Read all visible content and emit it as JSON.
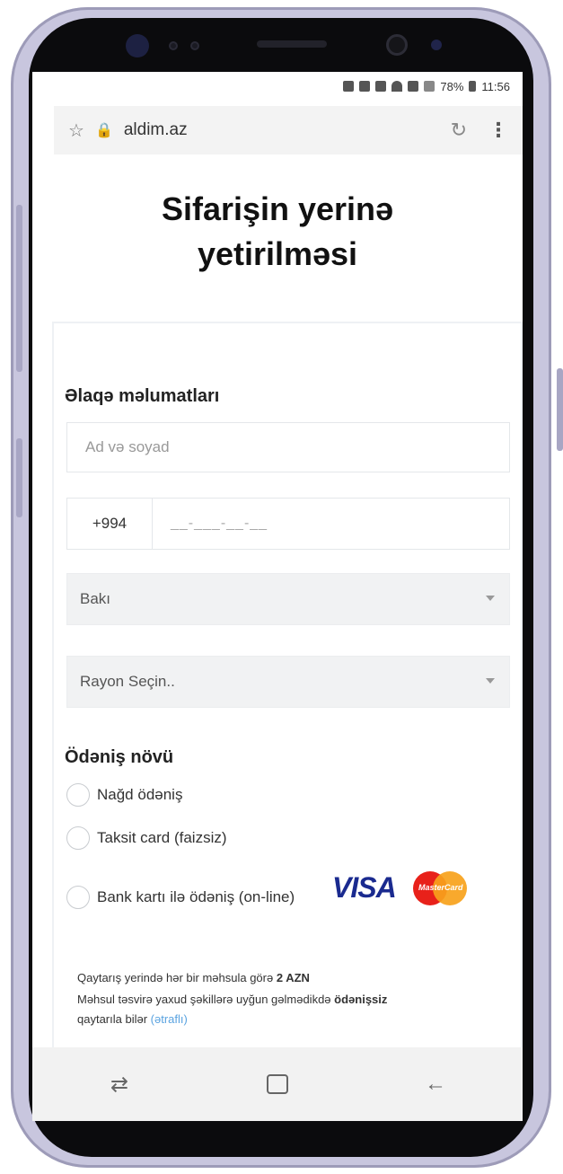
{
  "status_bar": {
    "battery": "78%",
    "time": "11:56"
  },
  "browser": {
    "url": "aldim.az"
  },
  "page": {
    "title_line1": "Sifarişin yerinə",
    "title_line2": "yetirilməsi"
  },
  "contact": {
    "title": "Əlaqə məlumatları",
    "name_placeholder": "Ad və soyad",
    "phone_code": "+994",
    "phone_placeholder": "__-___-__-__",
    "city_selected": "Bakı",
    "district_placeholder": "Rayon Seçin.."
  },
  "payment": {
    "title": "Ödəniş növü",
    "options": [
      "Nağd ödəniş",
      "Taksit card (faizsiz)",
      "Bank kartı ilə ödəniş (on-line)"
    ],
    "visa_label": "VISA",
    "mastercard_label": "MasterCard"
  },
  "return_info": {
    "line1_prefix": "Qaytarış yerində hər bir məhsula görə ",
    "line1_price": "2 AZN",
    "line2_prefix": "Məhsul təsvirə yaxud şəkillərə uyğun gəlmədikdə ",
    "line2_bold": "ödənişsiz",
    "line3_prefix": "qaytarıla bilər ",
    "line3_link": "(ətraflı)"
  },
  "colors": {
    "phone_frame": "#c8c6de",
    "visa_blue": "#1a2a8f",
    "mc_red": "#e8211a",
    "mc_orange": "#f7a21b",
    "link": "#5aa3e0"
  }
}
